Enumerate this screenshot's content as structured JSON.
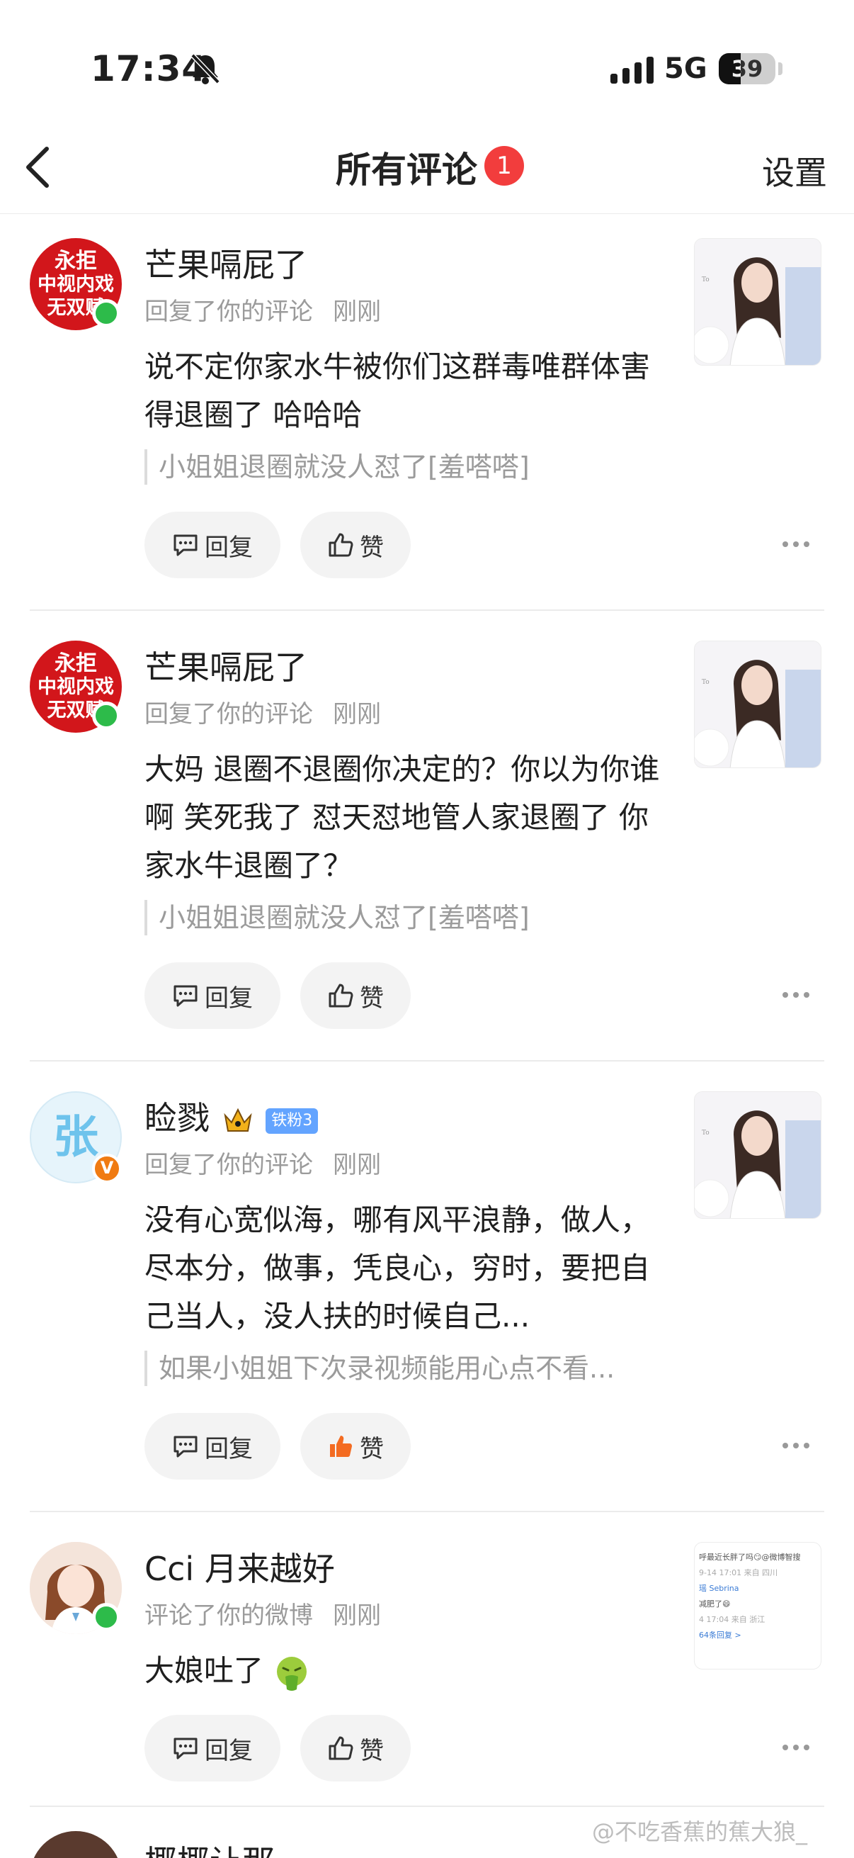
{
  "status_bar": {
    "time": "17:34",
    "network": "5G",
    "battery": "39",
    "battery_level_percent": 39
  },
  "nav": {
    "title": "所有评论",
    "badge_count": "1",
    "settings": "设置"
  },
  "actions": {
    "reply": "回复",
    "like": "赞"
  },
  "comments": [
    {
      "avatar_text": "永拒\n中视内戏\n无双赋",
      "username": "芒果嗝屁了",
      "action": "回复了你的评论",
      "time": "刚刚",
      "content": "说不定你家水牛被你们这群毒唯群体害得退圈了 哈哈哈",
      "quote": "小姐姐退圈就没人怼了[羞嗒嗒]",
      "liked": false
    },
    {
      "avatar_text": "永拒\n中视内戏\n无双赋",
      "username": "芒果嗝屁了",
      "action": "回复了你的评论",
      "time": "刚刚",
      "content": "大妈 退圈不退圈你决定的？你以为你谁啊 笑死我了 怼天怼地管人家退圈了 你家水牛退圈了？",
      "quote": "小姐姐退圈就没人怼了[羞嗒嗒]",
      "liked": false
    },
    {
      "avatar_text": "张",
      "username": "睑戮",
      "fan_badge": "铁粉3",
      "vip_mark": "V",
      "action": "回复了你的评论",
      "time": "刚刚",
      "content": "没有心宽似海，哪有风平浪静，做人，尽本分，做事，凭良心，穷时，要把自己当人，没人扶的时候自己...",
      "quote": "如果小姐姐下次录视频能用心点不看...",
      "liked": true
    },
    {
      "username": "Cci 月来越好",
      "action": "评论了你的微博",
      "time": "刚刚",
      "content": "大娘吐了",
      "liked": false,
      "thumb_lines": [
        "呼最近长胖了吗😏@微博智搜",
        "9-14 17:01 来自 四川",
        "瑶 Sebrina",
        "减肥了😄",
        "4 17:04 来自 浙江",
        "64条回复 >"
      ]
    }
  ],
  "partial_next": {
    "username": "椰椰让那"
  },
  "watermark": "@不吃香蕉的蕉大狼_",
  "colors": {
    "accent_red": "#f23d3d",
    "like_orange": "#f36b21",
    "online_green": "#2dbb4a",
    "vip_orange": "#f07b12",
    "fan_blue": "#63a4ff"
  },
  "icons": {
    "back": "chevron-left-icon",
    "bell": "bell-off-icon",
    "reply": "comment-icon",
    "like": "thumbs-up-icon",
    "more": "more-dots-icon"
  }
}
